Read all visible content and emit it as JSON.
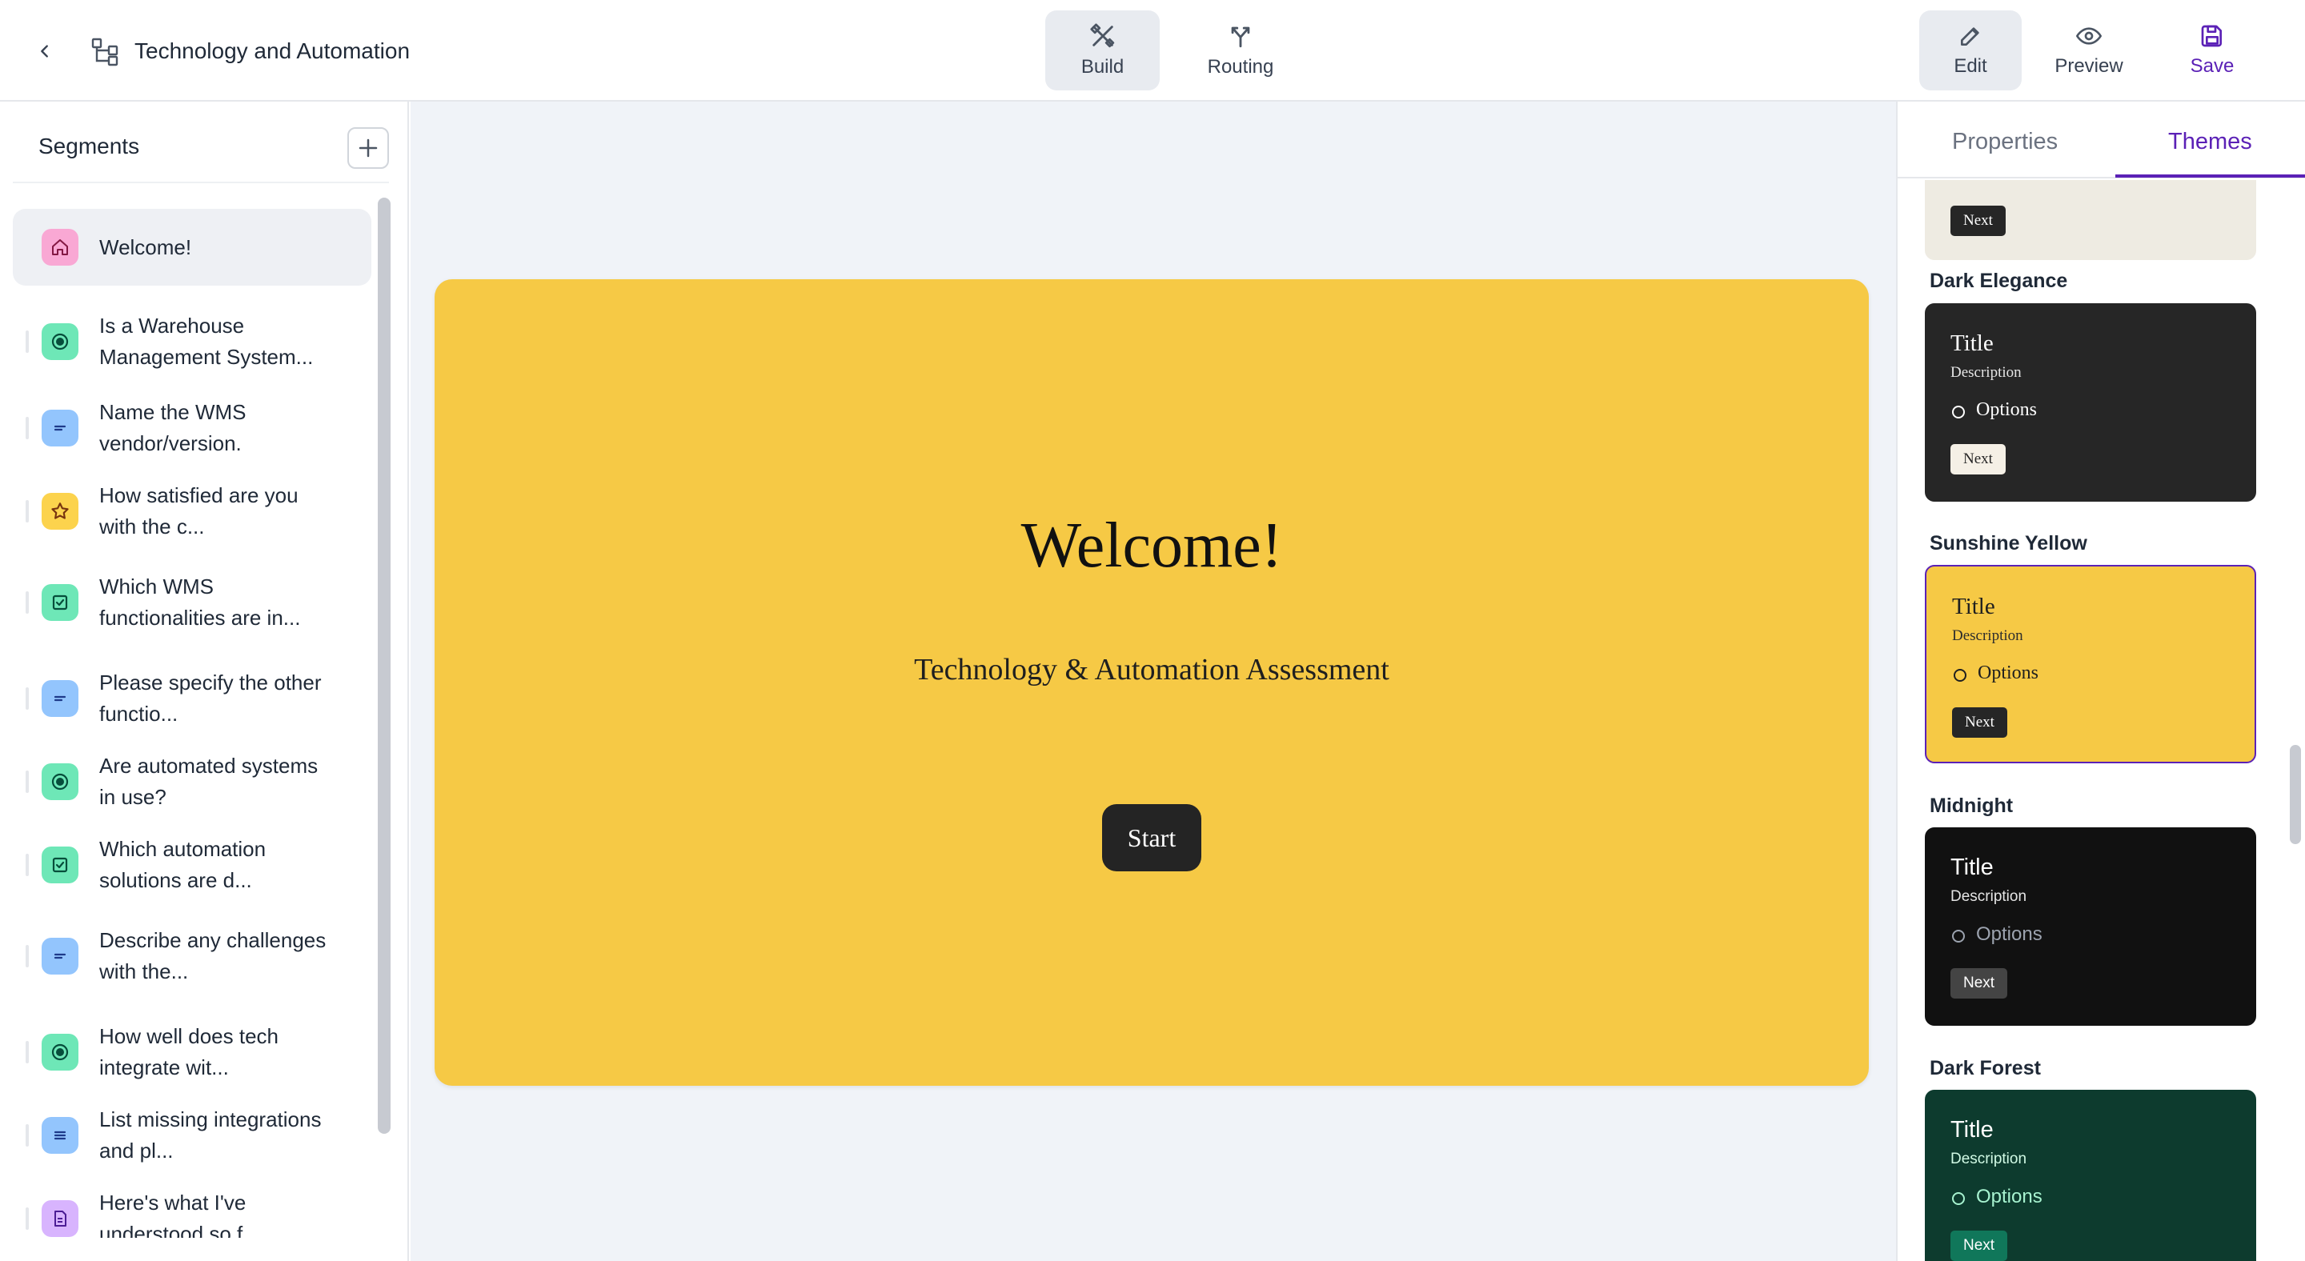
{
  "header": {
    "title": "Technology and Automation",
    "nav": [
      {
        "label": "Build",
        "icon": "build-tools-icon",
        "active": true
      },
      {
        "label": "Routing",
        "icon": "routing-fork-icon",
        "active": false
      }
    ],
    "actions": [
      {
        "label": "Edit",
        "icon": "pencil-icon",
        "active": true
      },
      {
        "label": "Preview",
        "icon": "eye-icon",
        "active": false
      },
      {
        "label": "Save",
        "icon": "floppy-disk-icon",
        "active": false
      }
    ]
  },
  "sidebar": {
    "heading": "Segments",
    "items": [
      {
        "label": "Welcome!",
        "icon": "home-icon",
        "icon_bg": "#f9a8d4"
      },
      {
        "label": "Is a Warehouse Management System...",
        "icon": "radio-icon",
        "icon_bg": "#6ee7b7"
      },
      {
        "label": "Name the WMS vendor/version.",
        "icon": "short-text-icon",
        "icon_bg": "#93c5fd"
      },
      {
        "label": "How satisfied are you with the c...",
        "icon": "star-icon",
        "icon_bg": "#fcd34d"
      },
      {
        "label": "Which WMS functionalities are in...",
        "icon": "checkbox-icon",
        "icon_bg": "#6ee7b7"
      },
      {
        "label": "Please specify the other functio...",
        "icon": "short-text-icon",
        "icon_bg": "#93c5fd"
      },
      {
        "label": "Are automated systems in use?",
        "icon": "radio-icon",
        "icon_bg": "#6ee7b7"
      },
      {
        "label": "Which automation solutions are d...",
        "icon": "checkbox-icon",
        "icon_bg": "#6ee7b7"
      },
      {
        "label": "Describe any challenges with the...",
        "icon": "short-text-icon",
        "icon_bg": "#93c5fd"
      },
      {
        "label": "How well does tech integrate wit...",
        "icon": "radio-icon",
        "icon_bg": "#6ee7b7"
      },
      {
        "label": "List missing integrations and pl...",
        "icon": "long-text-icon",
        "icon_bg": "#93c5fd"
      },
      {
        "label": "Here's what I've understood so f...",
        "icon": "document-icon",
        "icon_bg": "#d8b4fe"
      }
    ]
  },
  "canvas": {
    "title": "Welcome!",
    "subtitle": "Technology & Automation Assessment",
    "button": "Start",
    "background": "#f6c945"
  },
  "panel": {
    "tabs": [
      {
        "label": "Properties",
        "active": false
      },
      {
        "label": "Themes",
        "active": true
      }
    ],
    "partial_theme_next": "Next",
    "themes": [
      {
        "name": "Dark Elegance",
        "title": "Title",
        "description": "Description",
        "option": "Options",
        "next": "Next",
        "bg": "#262626",
        "fg": "#ffffff",
        "next_bg": "#f5f0e6",
        "next_fg": "#262626",
        "selected": false
      },
      {
        "name": "Sunshine Yellow",
        "title": "Title",
        "description": "Description",
        "option": "Options",
        "next": "Next",
        "bg": "#f6c945",
        "fg": "#1f1f1f",
        "next_bg": "#262626",
        "next_fg": "#ffffff",
        "selected": true
      },
      {
        "name": "Midnight",
        "title": "Title",
        "description": "Description",
        "option": "Options",
        "next": "Next",
        "bg": "#111111",
        "fg": "#ffffff",
        "next_bg": "#444444",
        "next_fg": "#ffffff",
        "selected": false
      },
      {
        "name": "Dark Forest",
        "title": "Title",
        "description": "Description",
        "option": "Options",
        "next": "Next",
        "bg": "#0d3b2e",
        "fg": "#ffffff",
        "next_bg": "#10775a",
        "next_fg": "#ffffff",
        "selected": false
      }
    ]
  },
  "colors": {
    "accent": "#5b21b6",
    "canvas_bg": "#f0f3f8"
  }
}
